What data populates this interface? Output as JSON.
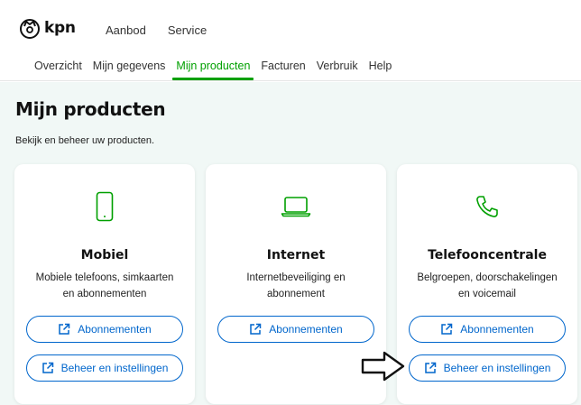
{
  "header": {
    "logo_text": "kpn",
    "nav": [
      "Aanbod",
      "Service"
    ]
  },
  "subnav": {
    "items": [
      "Overzicht",
      "Mijn gegevens",
      "Mijn producten",
      "Facturen",
      "Verbruik",
      "Help"
    ],
    "active": "Mijn producten"
  },
  "main": {
    "title": "Mijn producten",
    "subtitle": "Bekijk en beheer uw producten."
  },
  "cards": [
    {
      "icon": "mobile-phone-icon",
      "title": "Mobiel",
      "desc_line1": "Mobiele telefoons, simkaarten",
      "desc_line2": "en abonnementen",
      "buttons": [
        "Abonnementen",
        "Beheer en instellingen"
      ]
    },
    {
      "icon": "laptop-icon",
      "title": "Internet",
      "desc_line1": "Internetbeveiliging en",
      "desc_line2": "abonnement",
      "buttons": [
        "Abonnementen"
      ]
    },
    {
      "icon": "phone-handset-icon",
      "title": "Telefooncentrale",
      "desc_line1": "Belgroepen, doorschakelingen",
      "desc_line2": "en voicemail",
      "buttons": [
        "Abonnementen",
        "Beheer en instellingen"
      ]
    }
  ],
  "colors": {
    "accent_green": "#00a000",
    "button_blue": "#0066cc",
    "main_bg": "#f1f8f6"
  }
}
